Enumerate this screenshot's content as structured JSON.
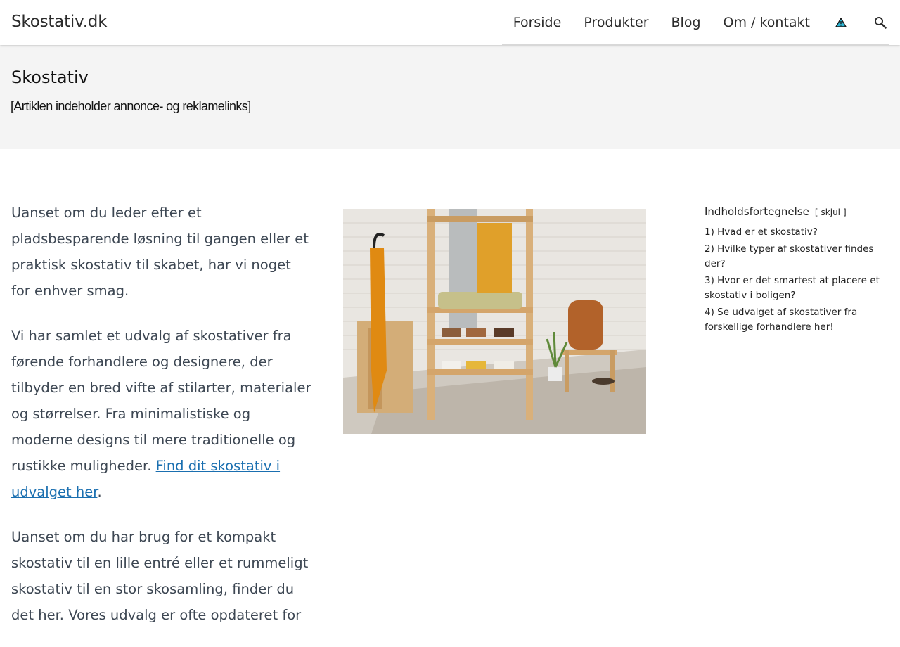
{
  "header": {
    "site_title": "Skostativ.dk",
    "nav": [
      "Forside",
      "Produkter",
      "Blog",
      "Om / kontakt"
    ],
    "icons": [
      "warning-icon",
      "search-icon"
    ]
  },
  "hero": {
    "title": "Skostativ",
    "disclaimer": "[Artiklen indeholder annonce- og reklamelinks]"
  },
  "main": {
    "p1": "Uanset om du leder efter et pladsbesparende løsning til gangen eller et praktisk skostativ til skabet, har vi noget for enhver smag.",
    "p2_text": "Vi har samlet et udvalg af skostativer fra førende forhandlere og designere, der tilbyder en bred vifte af stilarter, materialer og størrelser. Fra minimalistiske og moderne designs til mere traditionelle og rustikke muligheder. ",
    "p2_link": "Find dit skostativ i udvalget her",
    "p2_end": ".",
    "p3": "Uanset om du har brug for et kompakt skostativ til en lille entré eller et rummeligt skostativ til en stor skosamling, finder du det her. Vores udvalg er ofte opdateret for"
  },
  "toc": {
    "title": "Indholdsfortegnelse",
    "toggle_open": "[",
    "toggle_label": "skjul",
    "toggle_close": "]",
    "items": [
      {
        "num": "1)",
        "label": "Hvad er et skostativ?"
      },
      {
        "num": "2)",
        "label": "Hvilke typer af skostativer findes der?"
      },
      {
        "num": "3)",
        "label": "Hvor er det smartest at placere et skostativ i boligen?"
      },
      {
        "num": "4)",
        "label": "Se udvalget af skostativer fra forskellige forhandlere her!"
      }
    ]
  },
  "colors": {
    "link": "#1a6fb0",
    "hero_bg": "#f4f4f4",
    "body_text": "#3d4753"
  }
}
